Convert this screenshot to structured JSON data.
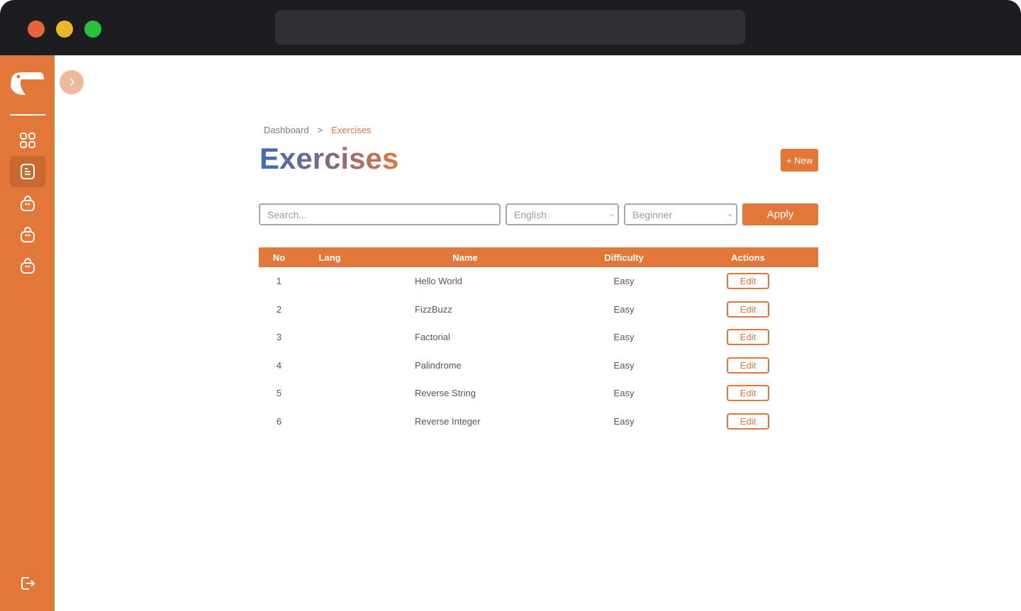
{
  "window": {
    "dots": [
      "#e5663a",
      "#f0b42a",
      "#29c03a"
    ]
  },
  "breadcrumb": {
    "parent": "Dashboard",
    "separator": ">",
    "current": "Exercises"
  },
  "page": {
    "title": "Exercises",
    "new_label": "+ New"
  },
  "filters": {
    "search_placeholder": "Search...",
    "language": "English",
    "difficulty": "Beginner",
    "apply_label": "Apply"
  },
  "table": {
    "headers": [
      "No",
      "Lang",
      "Name",
      "Difficulty",
      "Actions"
    ],
    "rows": [
      {
        "no": "1",
        "lang": "",
        "name": "Hello World",
        "difficulty": "Easy",
        "action": "Edit"
      },
      {
        "no": "2",
        "lang": "",
        "name": "FizzBuzz",
        "difficulty": "Easy",
        "action": "Edit"
      },
      {
        "no": "3",
        "lang": "",
        "name": "Factorial",
        "difficulty": "Easy",
        "action": "Edit"
      },
      {
        "no": "4",
        "lang": "",
        "name": "Palindrome",
        "difficulty": "Easy",
        "action": "Edit"
      },
      {
        "no": "5",
        "lang": "",
        "name": "Reverse String",
        "difficulty": "Easy",
        "action": "Edit"
      },
      {
        "no": "6",
        "lang": "",
        "name": "Reverse Integer",
        "difficulty": "Easy",
        "action": "Edit"
      }
    ]
  },
  "colors": {
    "accent": "#e3773a"
  }
}
